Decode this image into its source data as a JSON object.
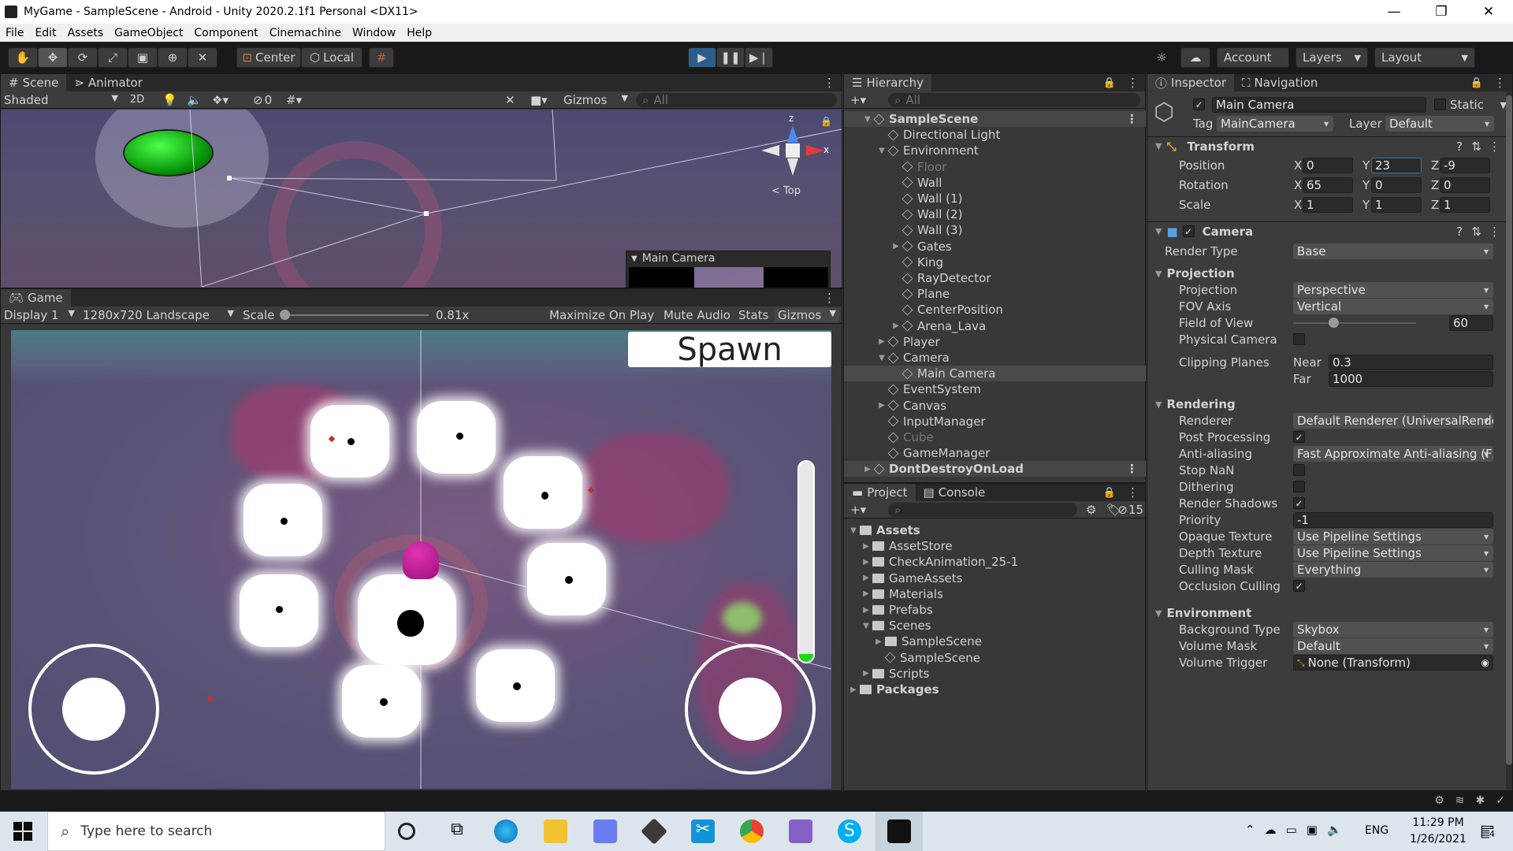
{
  "window": {
    "title": "MyGame - SampleScene - Android - Unity 2020.2.1f1 Personal <DX11>"
  },
  "menu": [
    "File",
    "Edit",
    "Assets",
    "GameObject",
    "Component",
    "Cinemachine",
    "Window",
    "Help"
  ],
  "toolbar": {
    "pivot": "Center",
    "space": "Local",
    "account": "Account",
    "layers": "Layers",
    "layout": "Layout"
  },
  "scene": {
    "tab": "Scene",
    "tab2": "Animator",
    "shading": "Shaded",
    "mode2d": "2D",
    "hidden_count": "0",
    "gizmos": "Gizmos",
    "search_placeholder": "All",
    "gizmo_label": "< Top",
    "z": "z",
    "x": "x",
    "camera_preview_title": "Main Camera"
  },
  "game": {
    "tab": "Game",
    "display": "Display 1",
    "resolution": "1280x720 Landscape",
    "scale_label": "Scale",
    "scale_value": "0.81x",
    "scale_fraction": 0.0,
    "maximize": "Maximize On Play",
    "mute": "Mute Audio",
    "stats": "Stats",
    "gizmos": "Gizmos",
    "spawn_button": "Spawn",
    "vertical_bar_fill": 0.04
  },
  "hierarchy": {
    "tab": "Hierarchy",
    "search_placeholder": "All",
    "items": [
      {
        "label": "SampleScene",
        "depth": 0,
        "arrow": "down",
        "scene": true
      },
      {
        "label": "Directional Light",
        "depth": 1
      },
      {
        "label": "Environment",
        "depth": 1,
        "arrow": "down"
      },
      {
        "label": "Floor",
        "depth": 2,
        "dim": true
      },
      {
        "label": "Wall",
        "depth": 2
      },
      {
        "label": "Wall (1)",
        "depth": 2
      },
      {
        "label": "Wall (2)",
        "depth": 2
      },
      {
        "label": "Wall (3)",
        "depth": 2
      },
      {
        "label": "Gates",
        "depth": 2,
        "arrow": "right"
      },
      {
        "label": "King",
        "depth": 2
      },
      {
        "label": "RayDetector",
        "depth": 2
      },
      {
        "label": "Plane",
        "depth": 2
      },
      {
        "label": "CenterPosition",
        "depth": 2
      },
      {
        "label": "Arena_Lava",
        "depth": 2,
        "arrow": "right"
      },
      {
        "label": "Player",
        "depth": 1,
        "arrow": "right"
      },
      {
        "label": "Camera",
        "depth": 1,
        "arrow": "down"
      },
      {
        "label": "Main Camera",
        "depth": 2,
        "selected": true
      },
      {
        "label": "EventSystem",
        "depth": 1
      },
      {
        "label": "Canvas",
        "depth": 1,
        "arrow": "right"
      },
      {
        "label": "InputManager",
        "depth": 1
      },
      {
        "label": "Cube",
        "depth": 1,
        "dim": true
      },
      {
        "label": "GameManager",
        "depth": 1
      },
      {
        "label": "DontDestroyOnLoad",
        "depth": 0,
        "arrow": "right",
        "scene": true
      }
    ]
  },
  "project": {
    "tab": "Project",
    "tab2": "Console",
    "hidden_count": "15",
    "items": [
      {
        "label": "Assets",
        "depth": 0,
        "arrow": "down",
        "bold": true
      },
      {
        "label": "AssetStore",
        "depth": 1,
        "arrow": "right"
      },
      {
        "label": "CheckAnimation_25-1",
        "depth": 1,
        "arrow": "right"
      },
      {
        "label": "GameAssets",
        "depth": 1,
        "arrow": "right"
      },
      {
        "label": "Materials",
        "depth": 1,
        "arrow": "right"
      },
      {
        "label": "Prefabs",
        "depth": 1,
        "arrow": "right"
      },
      {
        "label": "Scenes",
        "depth": 1,
        "arrow": "down"
      },
      {
        "label": "SampleScene",
        "depth": 2,
        "arrow": "right"
      },
      {
        "label": "SampleScene",
        "depth": 2,
        "scene": true
      },
      {
        "label": "Scripts",
        "depth": 1,
        "arrow": "right"
      },
      {
        "label": "Packages",
        "depth": 0,
        "arrow": "right",
        "bold": true
      }
    ]
  },
  "inspector": {
    "tab": "Inspector",
    "tab2": "Navigation",
    "object_name": "Main Camera",
    "static_label": "Static",
    "tag_label": "Tag",
    "tag_value": "MainCamera",
    "layer_label": "Layer",
    "layer_value": "Default",
    "transform": {
      "title": "Transform",
      "position_label": "Position",
      "rotation_label": "Rotation",
      "scale_label": "Scale",
      "position": {
        "x": "0",
        "y": "23",
        "z": "-9"
      },
      "rotation": {
        "x": "65",
        "y": "0",
        "z": "0"
      },
      "scale": {
        "x": "1",
        "y": "1",
        "z": "1"
      }
    },
    "camera": {
      "title": "Camera",
      "render_type_label": "Render Type",
      "render_type": "Base",
      "projection_section": "Projection",
      "projection_label": "Projection",
      "projection": "Perspective",
      "fov_axis_label": "FOV Axis",
      "fov_axis": "Vertical",
      "fov_label": "Field of View",
      "fov": "60",
      "fov_fraction": 0.33,
      "physical_label": "Physical Camera",
      "clipping_label": "Clipping Planes",
      "near_label": "Near",
      "near": "0.3",
      "far_label": "Far",
      "far": "1000",
      "rendering_section": "Rendering",
      "renderer_label": "Renderer",
      "renderer": "Default Renderer (UniversalRenderPipelineAsset_Renderer)",
      "post_label": "Post Processing",
      "aa_label": "Anti-aliasing",
      "aa": "Fast Approximate Anti-aliasing (FXAA)",
      "stopnan_label": "Stop NaN",
      "dither_label": "Dithering",
      "shadows_label": "Render Shadows",
      "priority_label": "Priority",
      "priority": "-1",
      "opaque_label": "Opaque Texture",
      "opaque": "Use Pipeline Settings",
      "depth_label": "Depth Texture",
      "depth": "Use Pipeline Settings",
      "culling_label": "Culling Mask",
      "culling": "Everything",
      "occlusion_label": "Occlusion Culling",
      "environment_section": "Environment",
      "bg_label": "Background Type",
      "bg": "Skybox",
      "volume_mask_label": "Volume Mask",
      "volume_mask": "Default",
      "volume_trigger_label": "Volume Trigger",
      "volume_trigger": "None (Transform)"
    }
  },
  "taskbar": {
    "search_placeholder": "Type here to search",
    "lang": "ENG",
    "time": "11:29 PM",
    "date": "1/26/2021",
    "notif_count": "4"
  },
  "colors": {
    "accent": "#3a72b0",
    "play_active": "#2d5d8a",
    "selection": "#2c5d87"
  }
}
